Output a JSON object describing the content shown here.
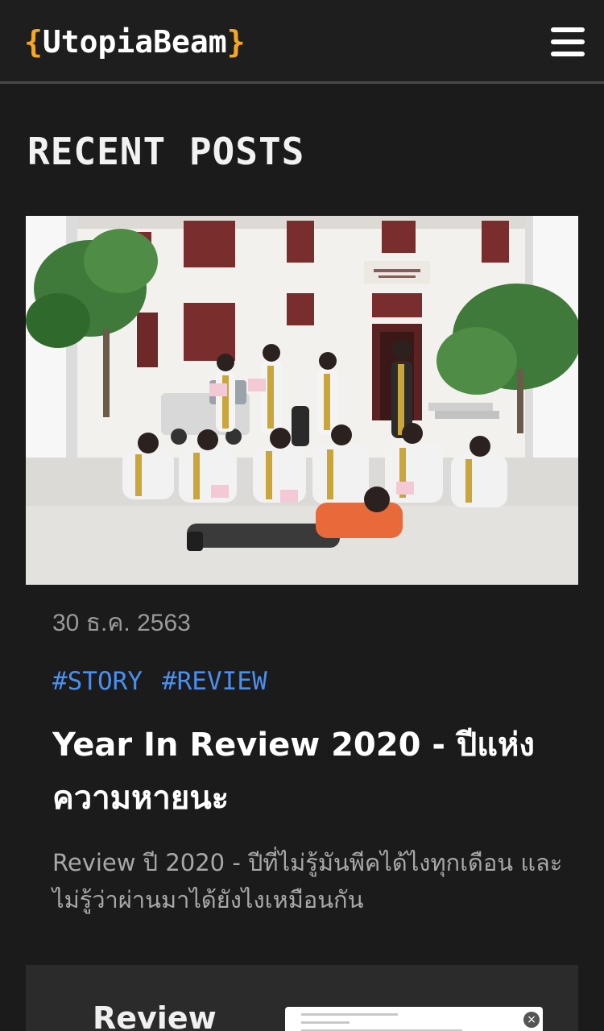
{
  "header": {
    "logo_brace_open": "{",
    "logo_text": "UtopiaBeam",
    "logo_brace_close": "}",
    "menu_icon": "hamburger-menu-icon",
    "brand_color": "#f5a623"
  },
  "section": {
    "title": "RECENT POSTS"
  },
  "posts": [
    {
      "image_description_icon": "photo-graduation-group",
      "date": "30 ธ.ค. 2563",
      "tags": [
        "#STORY",
        "#REVIEW"
      ],
      "title": "Year In Review 2020 - ปีแห่งความหายนะ",
      "excerpt": "Review ปี 2020 - ปีที่ไม่รู้มันพีคได้ไงทุกเดือน และไม่รู้ว่าผ่านมาได้ยังไงเหมือนกัน"
    },
    {
      "thumb_text": "Review",
      "close_glyph": "×"
    }
  ],
  "colors": {
    "background": "#1b1b1b",
    "tag_link": "#4a8ff0",
    "date_text": "#9a9a9a"
  }
}
